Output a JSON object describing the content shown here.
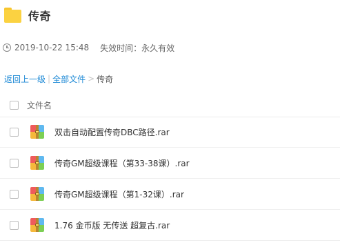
{
  "header": {
    "title": "传奇",
    "icon": "folder-icon"
  },
  "meta": {
    "date": "2019-10-22 15:48",
    "expiry": "失效时间：永久有效"
  },
  "breadcrumb": {
    "back": "返回上一级",
    "divider": "|",
    "all": "全部文件",
    "arrow": ">",
    "current": "传奇"
  },
  "table": {
    "header": "文件名",
    "files": [
      {
        "name": "双击自动配置传奇DBC路径.rar"
      },
      {
        "name": "传奇GM超级课程（第33-38课）.rar"
      },
      {
        "name": "传奇GM超级课程（第1-32课）.rar"
      },
      {
        "name": "1.76 金币版 无传送 超复古.rar"
      }
    ]
  },
  "colors": {
    "link": "#1f8ad6",
    "folder": "#fbd241"
  }
}
